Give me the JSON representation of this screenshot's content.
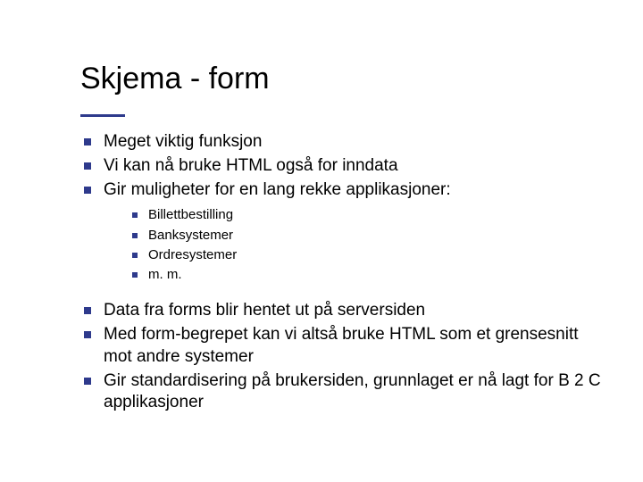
{
  "title": "Skjema - form",
  "bullets": [
    "Meget viktig funksjon",
    "Vi kan nå bruke HTML også for inndata",
    "Gir muligheter for en lang rekke applikasjoner:"
  ],
  "sub_bullets": [
    "Billettbestilling",
    "Banksystemer",
    "Ordresystemer",
    "m. m."
  ],
  "bullets_after": [
    "Data fra forms blir hentet ut på serversiden",
    "Med form-begrepet kan vi altså bruke HTML som et grensesnitt mot andre systemer",
    "Gir standardisering på brukersiden, grunnlaget er nå lagt for B 2 C applikasjoner"
  ]
}
